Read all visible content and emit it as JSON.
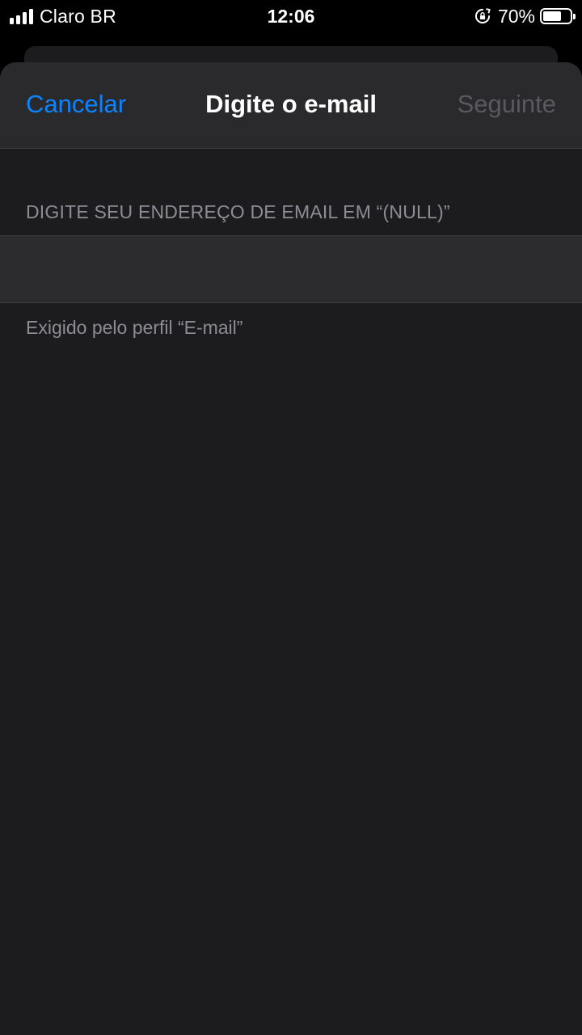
{
  "status_bar": {
    "carrier": "Claro BR",
    "time": "12:06",
    "battery_percent": "70%",
    "battery_level": 0.7,
    "signal_bars": 4,
    "icons": [
      "signal-icon",
      "rotation-lock-icon",
      "battery-icon"
    ]
  },
  "nav": {
    "cancel_label": "Cancelar",
    "title": "Digite o e-mail",
    "next_label": "Seguinte"
  },
  "form": {
    "section_header": "DIGITE SEU ENDEREÇO DE EMAIL EM “(NULL)”",
    "email_value": "",
    "section_footer": "Exigido pelo perfil “E-mail”"
  },
  "colors": {
    "accent": "#0a84ff",
    "disabled": "#5a5a5e",
    "sheet_background": "#1c1c1e",
    "nav_background": "#2a2a2c",
    "secondary_text": "#8d8d93"
  }
}
